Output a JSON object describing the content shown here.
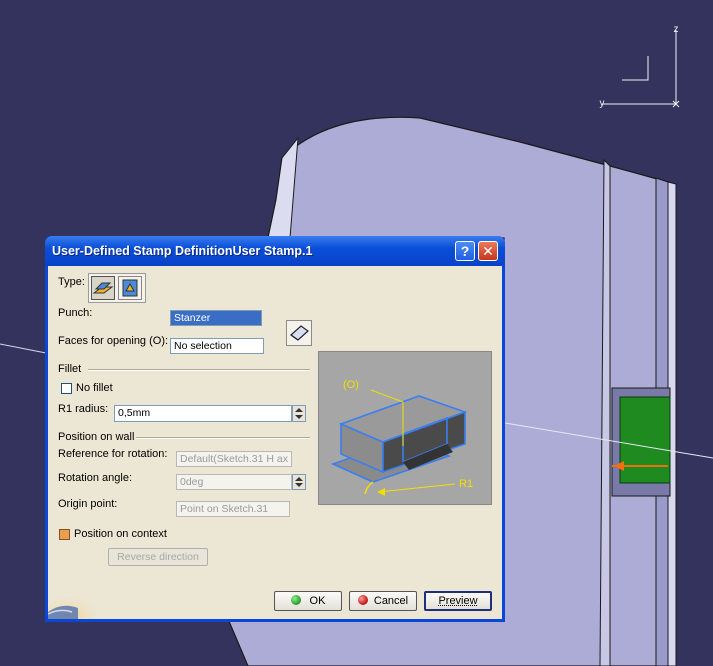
{
  "viewport": {
    "axes": {
      "z_label": "z",
      "y_label": "y"
    }
  },
  "dialog": {
    "title": "User-Defined Stamp DefinitionUser Stamp.1",
    "help_button": "?",
    "close_button": "✕",
    "type_label": "Type:",
    "punch_label": "Punch:",
    "punch_value": "Stanzer",
    "faces_label": "Faces for opening (O):",
    "faces_value": "No selection",
    "fillet_section": "Fillet",
    "no_fillet_label": "No fillet",
    "r1_label": "R1 radius:",
    "r1_value": "0,5mm",
    "position_section": "Position on wall",
    "ref_rotation_label": "Reference for rotation:",
    "ref_rotation_value": "Default(Sketch.31 H ax",
    "rotation_angle_label": "Rotation angle:",
    "rotation_angle_value": "0deg",
    "origin_label": "Origin point:",
    "origin_value": "Point on Sketch.31",
    "position_context_label": "Position on context",
    "reverse_label": "Reverse direction",
    "preview_labels": {
      "opening": "(O)",
      "radius": "R1"
    },
    "ok_label": "OK",
    "cancel_label": "Cancel",
    "preview_label": "Preview"
  },
  "colors": {
    "background": "#33335e",
    "part_surface": "#acacd6",
    "titlebar": "#0a4fd8",
    "dialog_body": "#ece6d4",
    "ok_dot": "#2ea82e",
    "cancel_dot": "#d02020",
    "green_feature": "#1f8a1f",
    "arrow": "#f07010"
  }
}
